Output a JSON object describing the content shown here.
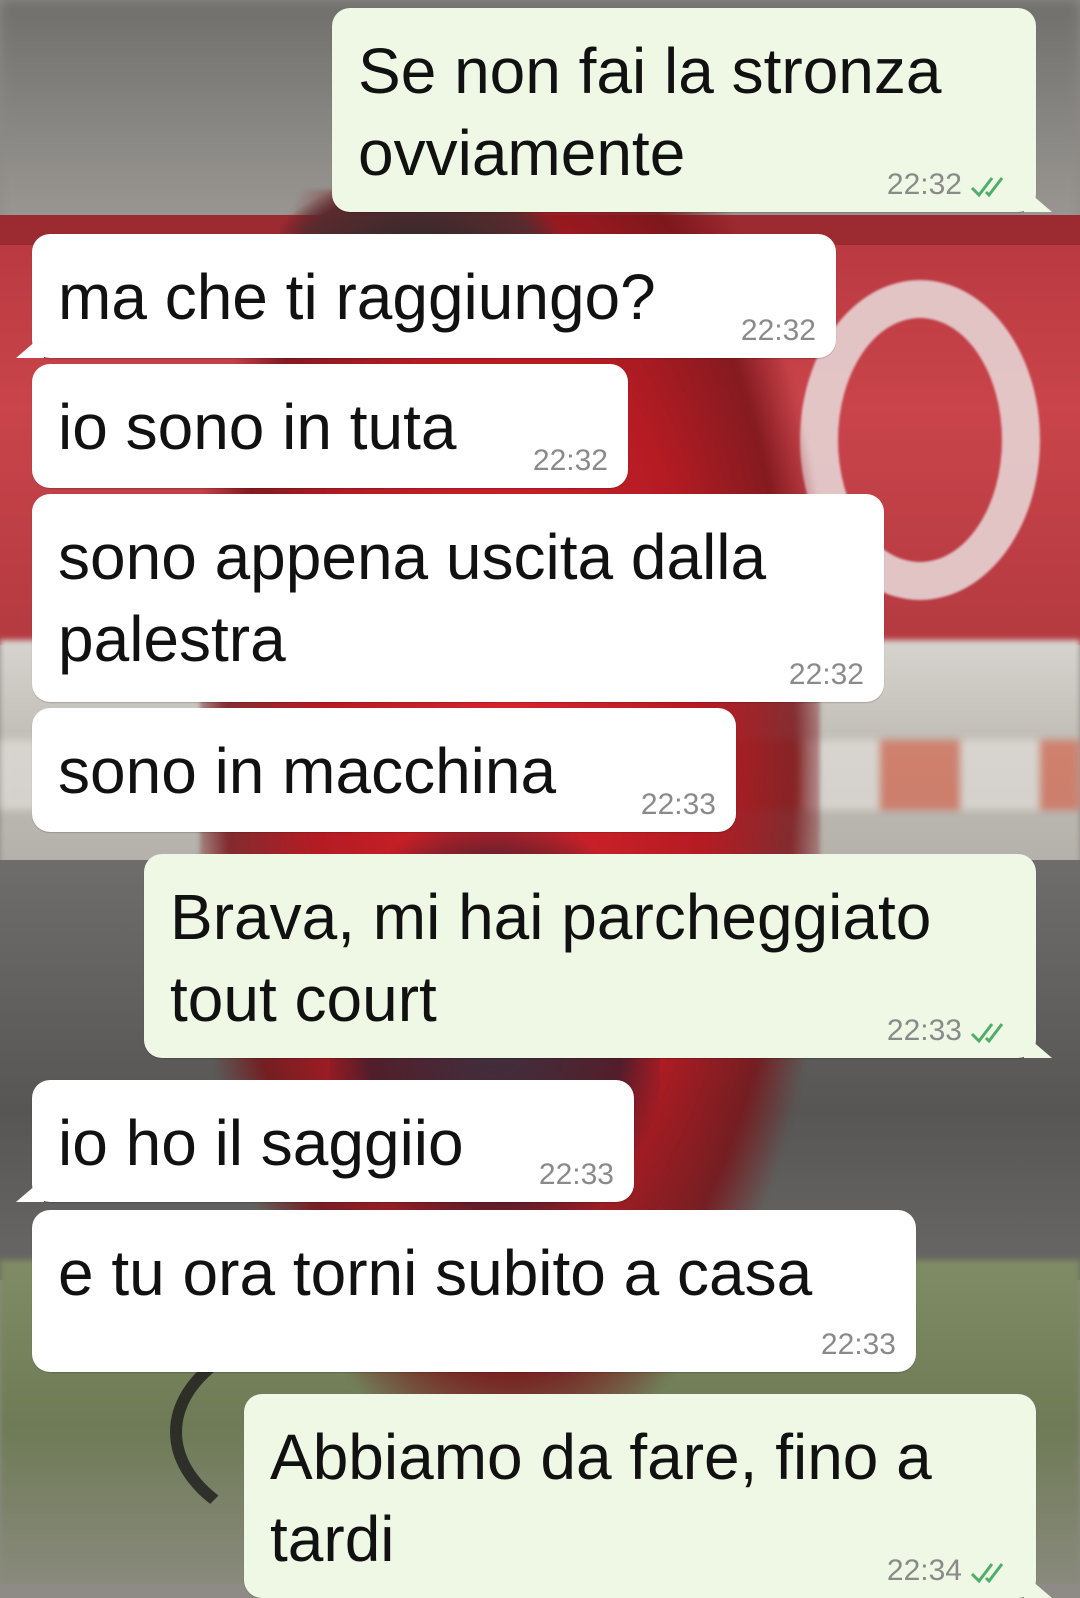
{
  "colors": {
    "incoming_bubble": "#ffffff",
    "outgoing_bubble": "#eff8e5",
    "timestamp": "#8a8a8a",
    "read_ticks": "#4fae6a"
  },
  "messages": [
    {
      "direction": "out",
      "text": "Se non fai la stronza\novviamente",
      "time": "22:32",
      "status": "read-ticks-icon"
    },
    {
      "direction": "in",
      "text": "ma che ti raggiungo?",
      "time": "22:32"
    },
    {
      "direction": "in",
      "text": "io sono in tuta",
      "time": "22:32"
    },
    {
      "direction": "in",
      "text": "sono appena uscita dalla\npalestra",
      "time": "22:32"
    },
    {
      "direction": "in",
      "text": "sono in macchina",
      "time": "22:33"
    },
    {
      "direction": "out",
      "text": "Brava, mi hai parcheggiato\ntout court",
      "time": "22:33",
      "status": "read-ticks-icon"
    },
    {
      "direction": "in",
      "text": "io ho il saggiio",
      "time": "22:33"
    },
    {
      "direction": "in",
      "text": "e tu ora torni subito a casa",
      "time": "22:33"
    },
    {
      "direction": "out",
      "text": "Abbiamo da fare, fino a\ntardi",
      "time": "22:34",
      "status": "read-ticks-icon"
    }
  ]
}
